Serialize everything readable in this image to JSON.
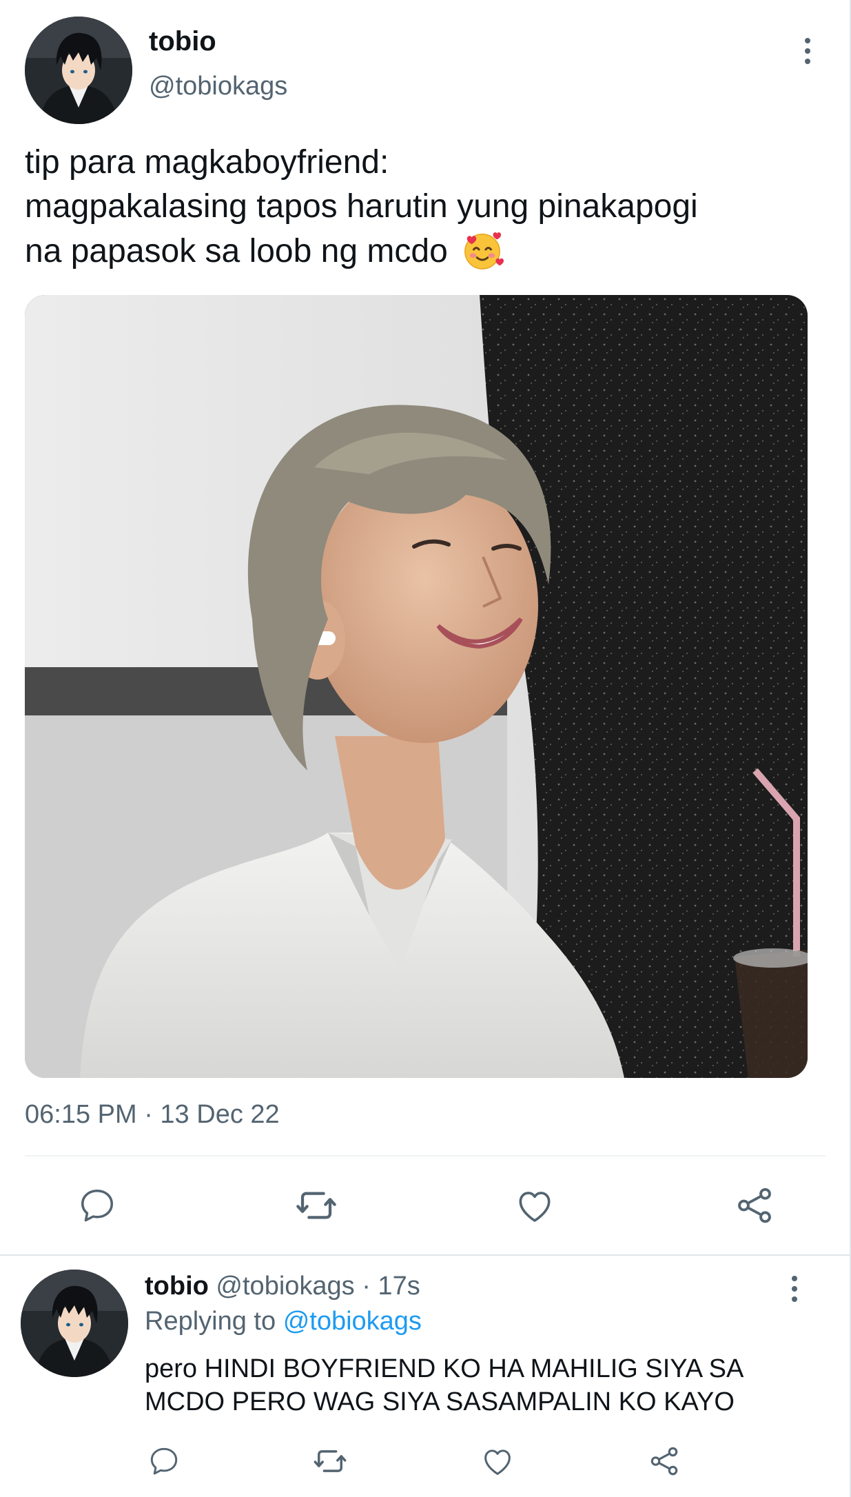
{
  "tweet": {
    "author_name": "tobio",
    "author_handle": "@tobiokags",
    "text_lines": [
      "tip para magkaboyfriend:",
      "magpakalasing tapos harutin yung pinakapogi",
      "na papasok sa loob ng mcdo"
    ],
    "emoji": "smiling-face-with-hearts",
    "timestamp": "06:15 PM · 13 Dec 22",
    "media": "photo",
    "icons": {
      "more": "more-vertical-icon",
      "reply": "reply-icon",
      "retweet": "retweet-icon",
      "like": "heart-icon",
      "share": "share-icon"
    }
  },
  "reply": {
    "author_name": "tobio",
    "author_meta": "@tobiokags · 17s",
    "replying_prefix": "Replying to",
    "replying_handle": "@tobiokags",
    "text_lines": [
      "pero HINDI BOYFRIEND KO HA MAHILIG SIYA SA",
      "MCDO PERO WAG SIYA SASAMPALIN KO KAYO"
    ]
  },
  "colors": {
    "text_primary": "#0f1419",
    "text_secondary": "#536471",
    "link": "#1d9bf0",
    "divider": "#eff3f4"
  }
}
